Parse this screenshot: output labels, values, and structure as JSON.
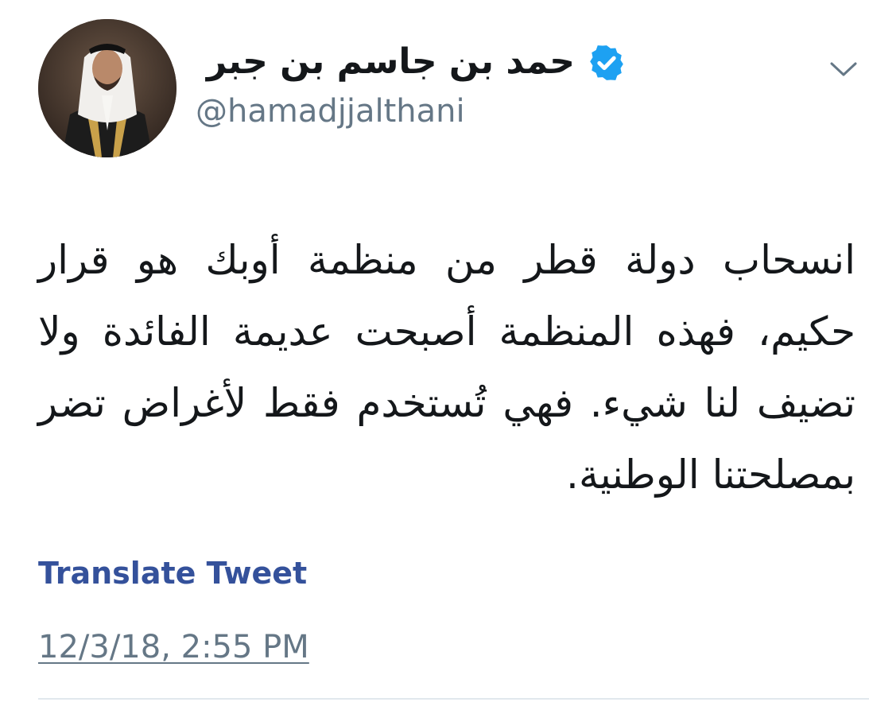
{
  "tweet": {
    "author": {
      "display_name": "حمد بن جاسم بن جبر",
      "handle": "@hamadjjalthani",
      "verified": true,
      "verified_badge_color": "#1da1f2",
      "avatar_icon": "avatar-photo"
    },
    "menu_icon": "chevron-down-icon",
    "text": "انسحاب دولة قطر من منظمة أوبك هو قرار حكيم، فهذه المنظمة أصبحت عديمة الفائدة ولا تضيف لنا شيء. فهي تُستخدم فقط لأغراض تضر بمصلحتنا الوطنية.",
    "translate_label": "Translate Tweet",
    "translate_color": "#34519b",
    "timestamp": "12/3/18, 2:55 PM"
  }
}
